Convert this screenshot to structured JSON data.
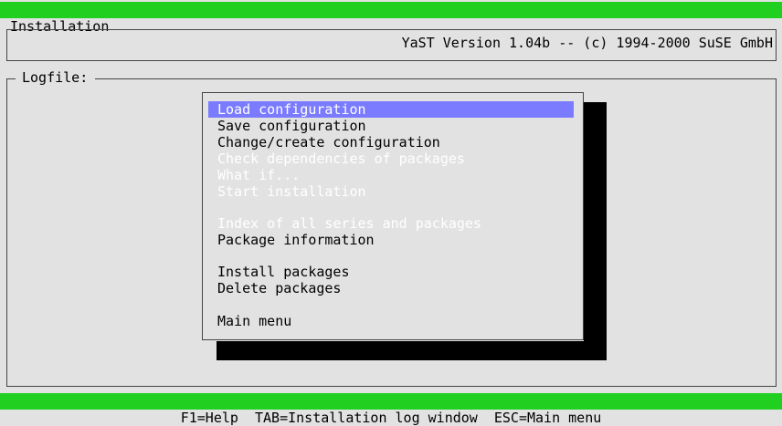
{
  "top_bar": {
    "title": "Installation",
    "version": "YaST Version 1.04b -- (c) 1994-2000 SuSE GmbH"
  },
  "message_box": {
    "text": ""
  },
  "logfile": {
    "label": "Logfile:"
  },
  "menu": {
    "items": [
      {
        "label": "Load configuration",
        "state": "selected"
      },
      {
        "label": "Save configuration",
        "state": "enabled"
      },
      {
        "label": "Change/create configuration",
        "state": "enabled"
      },
      {
        "label": "Check dependencies of packages",
        "state": "disabled"
      },
      {
        "label": "What if...",
        "state": "disabled"
      },
      {
        "label": "Start installation",
        "state": "disabled"
      },
      {
        "label": "Index of all series and packages",
        "state": "disabled"
      },
      {
        "label": "Package information",
        "state": "enabled"
      },
      {
        "label": "Install packages",
        "state": "enabled"
      },
      {
        "label": "Delete packages",
        "state": "enabled"
      },
      {
        "label": "Main menu",
        "state": "enabled"
      }
    ]
  },
  "bottom_bar": {
    "help_text": "F1=Help  TAB=Installation log window  ESC=Main menu"
  },
  "colors": {
    "bar_green": "#21cf21",
    "background": "#e2e2e2",
    "selection": "#7b7bff",
    "disabled_text": "#ffffff"
  }
}
